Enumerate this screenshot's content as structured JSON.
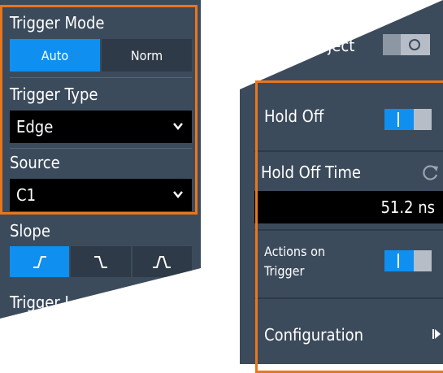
{
  "left": {
    "trigger_mode": {
      "label": "Trigger Mode",
      "options": [
        "Auto",
        "Norm"
      ],
      "selected": "Auto"
    },
    "trigger_type": {
      "label": "Trigger Type",
      "value": "Edge"
    },
    "source": {
      "label": "Source",
      "value": "C1"
    },
    "slope": {
      "label": "Slope",
      "options": [
        "rising-edge-icon",
        "falling-edge-icon",
        "both-edges-icon"
      ],
      "selected": "rising-edge-icon"
    },
    "trigger_level": {
      "label": "Trigger L"
    }
  },
  "right": {
    "noise_reject": {
      "label": "Noise Reject",
      "state": "off"
    },
    "hold_off": {
      "label": "Hold Off",
      "state": "on"
    },
    "hold_off_time": {
      "label": "Hold Off Time",
      "value": "51.2 ns",
      "reset_icon": "reset-icon"
    },
    "actions_on_trigger": {
      "label_line1": "Actions on",
      "label_line2": "Trigger",
      "state": "on"
    },
    "configuration": {
      "label": "Configuration",
      "icon": "play-arrow-icon"
    }
  },
  "colors": {
    "accent": "#0f8ff0",
    "highlight": "#e8761c",
    "panel": "#3c4b5c",
    "field": "#000000"
  }
}
